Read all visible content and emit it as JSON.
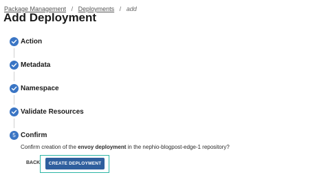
{
  "breadcrumb": {
    "items": [
      "Package Management",
      "Deployments"
    ],
    "separator": "/",
    "current": "add"
  },
  "page": {
    "title": "Add Deployment"
  },
  "steps": [
    {
      "label": "Action",
      "status": "completed"
    },
    {
      "label": "Metadata",
      "status": "completed"
    },
    {
      "label": "Namespace",
      "status": "completed"
    },
    {
      "label": "Validate Resources",
      "status": "completed"
    },
    {
      "label": "Confirm",
      "status": "active",
      "number": "5"
    }
  ],
  "confirm": {
    "prefix": "Confirm creation of the ",
    "emphasis": "envoy deployment",
    "suffix": " in the nephio-blogpost-edge-1 repository?"
  },
  "actions": {
    "back_label": "BACK",
    "create_label": "CREATE DEPLOYMENT"
  },
  "colors": {
    "accent": "#3a75c4",
    "primary_button": "#2f5f9e",
    "highlight": "#2bb5a5"
  },
  "icons": {
    "completed": "check-circle-icon"
  }
}
